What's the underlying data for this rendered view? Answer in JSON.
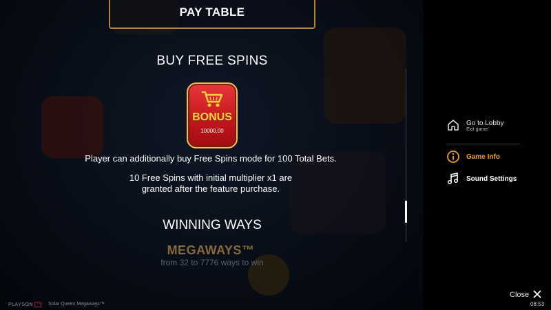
{
  "paytable": {
    "title": "PAY TABLE",
    "buy_section_title": "BUY FREE SPINS",
    "bonus_label": "BONUS",
    "bonus_price": "10000.00",
    "buy_description": "Player can additionally buy Free Spins mode for 100 Total Bets.",
    "spins_description_line1": "10 Free Spins with initial multiplier x1 are",
    "spins_description_line2": "granted after the feature purchase.",
    "winning_title": "WINNING WAYS",
    "megaways_logo": "MEGAWAYS™",
    "ways_text": "from 32 to 7776 ways to win"
  },
  "footer": {
    "brand": "PLAYSON",
    "game_name": "Solar Queen Megaways™"
  },
  "menu": {
    "lobby_label": "Go to Lobby",
    "lobby_sub": "Exit game",
    "game_info_label": "Game Info",
    "sound_label": "Sound Settings",
    "close_label": "Close",
    "clock": "08:53"
  },
  "colors": {
    "accent": "#f29b21",
    "frame": "#b8862e",
    "bonus_red": "#c2151b",
    "bonus_text": "#ffd43a"
  },
  "icons": {
    "home": "home-icon",
    "info": "info-icon",
    "music": "music-note-icon",
    "close": "close-icon",
    "cart": "shopping-cart-icon"
  }
}
